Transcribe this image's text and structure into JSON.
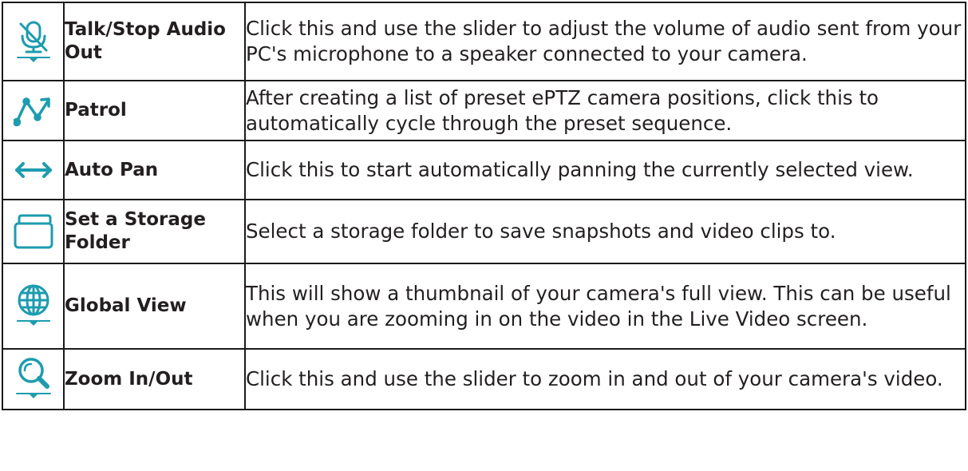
{
  "rows": [
    {
      "icon": "microphone-mute-icon",
      "name": "Talk/Stop Audio Out",
      "description": "Click this and use the slider to adjust the volume of audio sent from your PC's microphone to a speaker connected to your camera."
    },
    {
      "icon": "patrol-icon",
      "name": "Patrol",
      "description": "After creating a list of preset ePTZ camera positions, click this to automatically cycle through the preset sequence."
    },
    {
      "icon": "double-arrow-icon",
      "name": "Auto Pan",
      "description": "Click this to start automatically panning the currently selected view."
    },
    {
      "icon": "folder-icon",
      "name": "Set a Storage Folder",
      "description": "Select a storage folder to save snapshots and video clips to."
    },
    {
      "icon": "globe-icon",
      "name": "Global View",
      "description": "This will show a thumbnail of your camera's full view. This can be useful when you are zooming in on the video in the Live Video screen."
    },
    {
      "icon": "magnifier-icon",
      "name": "Zoom In/Out",
      "description": "Click this and use the slider to zoom in and out of your camera's video."
    }
  ],
  "colors": {
    "icon_teal": "#1d9cae",
    "text": "#231f20",
    "border": "#1a1a1a"
  }
}
